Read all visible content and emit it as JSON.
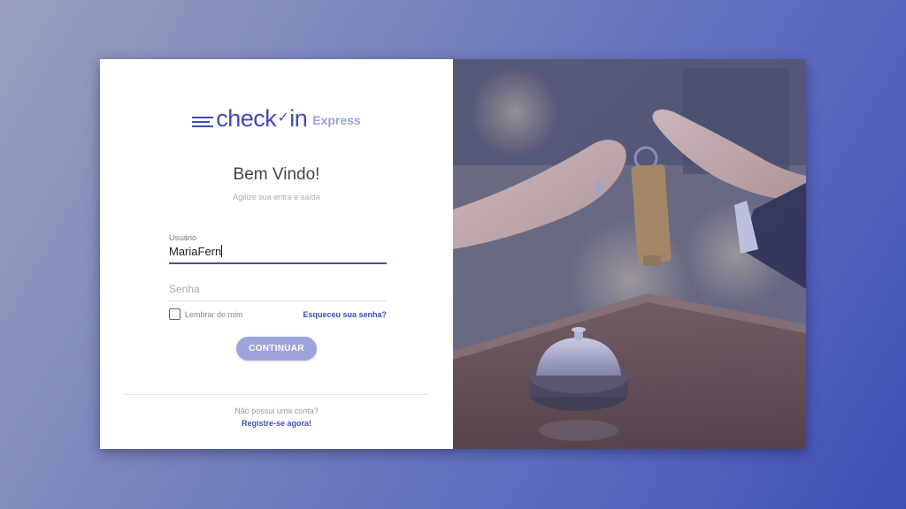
{
  "logo": {
    "main": "check",
    "check_mark": "✓",
    "main_end": "in",
    "sub": "Express"
  },
  "welcome": {
    "title": "Bem Vindo!",
    "tagline": "Agilize sua entra e saída"
  },
  "form": {
    "user_label": "Usuário",
    "user_value": "MariaFern",
    "password_placeholder": "Senha",
    "remember_label": "Lembrar de mim",
    "remember_checked": false,
    "forgot_link": "Esqueceu sua senha?",
    "submit_label": "CONTINUAR"
  },
  "footer": {
    "no_account": "Não possui uma conta?",
    "register_link": "Registre-se agora!"
  },
  "photo": {
    "subject": "hands-passing-hotel-key-with-service-bell"
  },
  "colors": {
    "brand": "#3f4cb5",
    "button": "#9da4dc",
    "logo_sub": "#9ba2d8"
  }
}
